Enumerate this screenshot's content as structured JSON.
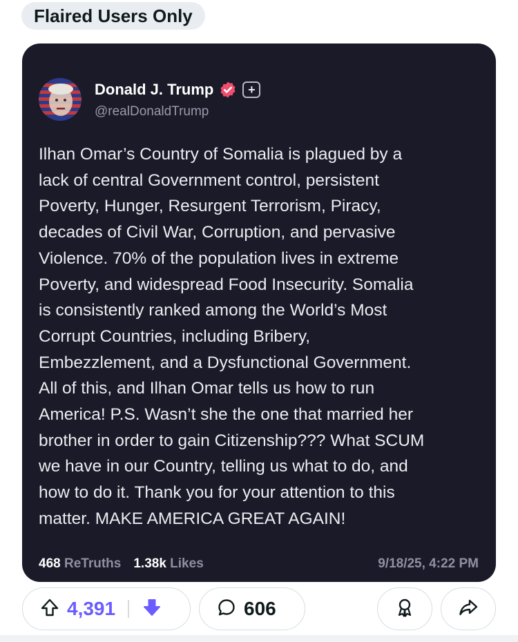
{
  "flair": {
    "label": "Flaired Users Only"
  },
  "post": {
    "author": {
      "display_name": "Donald J. Trump",
      "handle": "@realDonaldTrump",
      "verified_badge_icon": "verified-badge-icon",
      "plus_badge_label": "+"
    },
    "body": "Ilhan Omar’s Country of Somalia is plagued by a\nlack of central Government control, persistent\nPoverty, Hunger, Resurgent Terrorism, Piracy,\ndecades of Civil War, Corruption, and pervasive\nViolence. 70% of the population lives in extreme\nPoverty, and widespread Food Insecurity. Somalia\nis consistently ranked among the World’s Most\nCorrupt Countries, including Bribery,\nEmbezzlement, and a Dysfunctional Government.\nAll of this, and Ilhan Omar tells us how to run\nAmerica! P.S. Wasn’t she the one that married her\nbrother in order to gain Citizenship??? What SCUM\nwe have in our Country, telling us what to do, and\nhow to do it. Thank you for your attention to this\nmatter. MAKE AMERICA GREAT AGAIN!",
    "stats": {
      "retruths_count": "468",
      "retruths_label": "ReTruths",
      "likes_count": "1.38k",
      "likes_label": "Likes"
    },
    "timestamp": "9/18/25, 4:22 PM"
  },
  "actions": {
    "vote_count": "4,391",
    "comment_count": "606",
    "icons": {
      "upvote": "upvote-arrow-icon",
      "downvote": "downvote-arrow-icon",
      "comment": "comment-bubble-icon",
      "award": "award-ribbon-icon",
      "share": "share-arrow-icon"
    }
  },
  "colors": {
    "card_background": "#1a1a28",
    "vote_accent": "#6a5cff",
    "verified_badge": "#ef4f6e"
  }
}
